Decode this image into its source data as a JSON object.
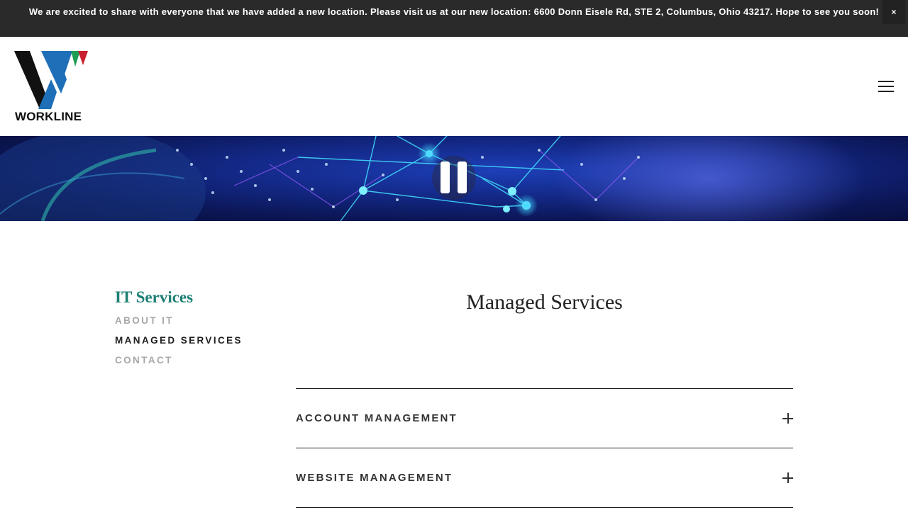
{
  "announcement": {
    "text": "We are excited to share with everyone that we have added a new location. Please visit us at our new location: 6600 Donn Eisele Rd, STE 2, Columbus, Ohio 43217. Hope to see you soon!",
    "close_label": "×"
  },
  "header": {
    "logo_text": "WORKLINE",
    "menu_icon": "hamburger-menu-icon"
  },
  "hero": {
    "control_icon": "pause-icon"
  },
  "sidenav": {
    "title": "IT Services",
    "items": [
      {
        "label": "ABOUT IT",
        "active": false
      },
      {
        "label": "MANAGED SERVICES",
        "active": true
      },
      {
        "label": "CONTACT",
        "active": false
      }
    ]
  },
  "main": {
    "title": "Managed Services",
    "accordion": [
      {
        "label": "ACCOUNT MANAGEMENT",
        "icon": "plus-icon"
      },
      {
        "label": "WEBSITE MANAGEMENT",
        "icon": "plus-icon"
      }
    ]
  },
  "colors": {
    "announcement_bg": "#2a2a2a",
    "accent_teal": "#1a7f72",
    "logo_black": "#111111",
    "logo_blue": "#1f6fb8",
    "logo_green": "#1e9e55",
    "logo_red": "#c8202e"
  }
}
